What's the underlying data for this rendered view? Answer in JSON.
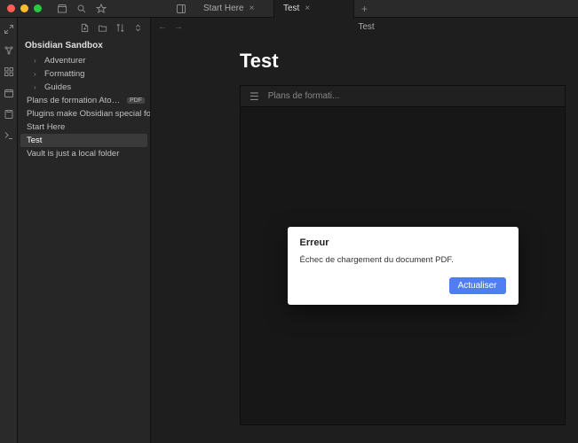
{
  "titlebar": {
    "tabs": [
      {
        "label": "Start Here",
        "active": false
      },
      {
        "label": "Test",
        "active": true
      }
    ]
  },
  "sidebar": {
    "vault_title": "Obsidian Sandbox",
    "items": [
      {
        "type": "folder",
        "label": "Adventurer"
      },
      {
        "type": "folder",
        "label": "Formatting"
      },
      {
        "type": "folder",
        "label": "Guides"
      },
      {
        "type": "file",
        "label": "Plans de formation Atomic Knowled…",
        "badge": "PDF"
      },
      {
        "type": "file",
        "label": "Plugins make Obsidian special for you"
      },
      {
        "type": "file",
        "label": "Start Here"
      },
      {
        "type": "file",
        "label": "Test",
        "active": true
      },
      {
        "type": "file",
        "label": "Vault is just a local folder"
      }
    ]
  },
  "content": {
    "header_title": "Test",
    "note_title": "Test",
    "embed": {
      "filename": "Plans de formati..."
    }
  },
  "modal": {
    "title": "Erreur",
    "message": "Échec de chargement du document PDF.",
    "button": "Actualiser"
  }
}
